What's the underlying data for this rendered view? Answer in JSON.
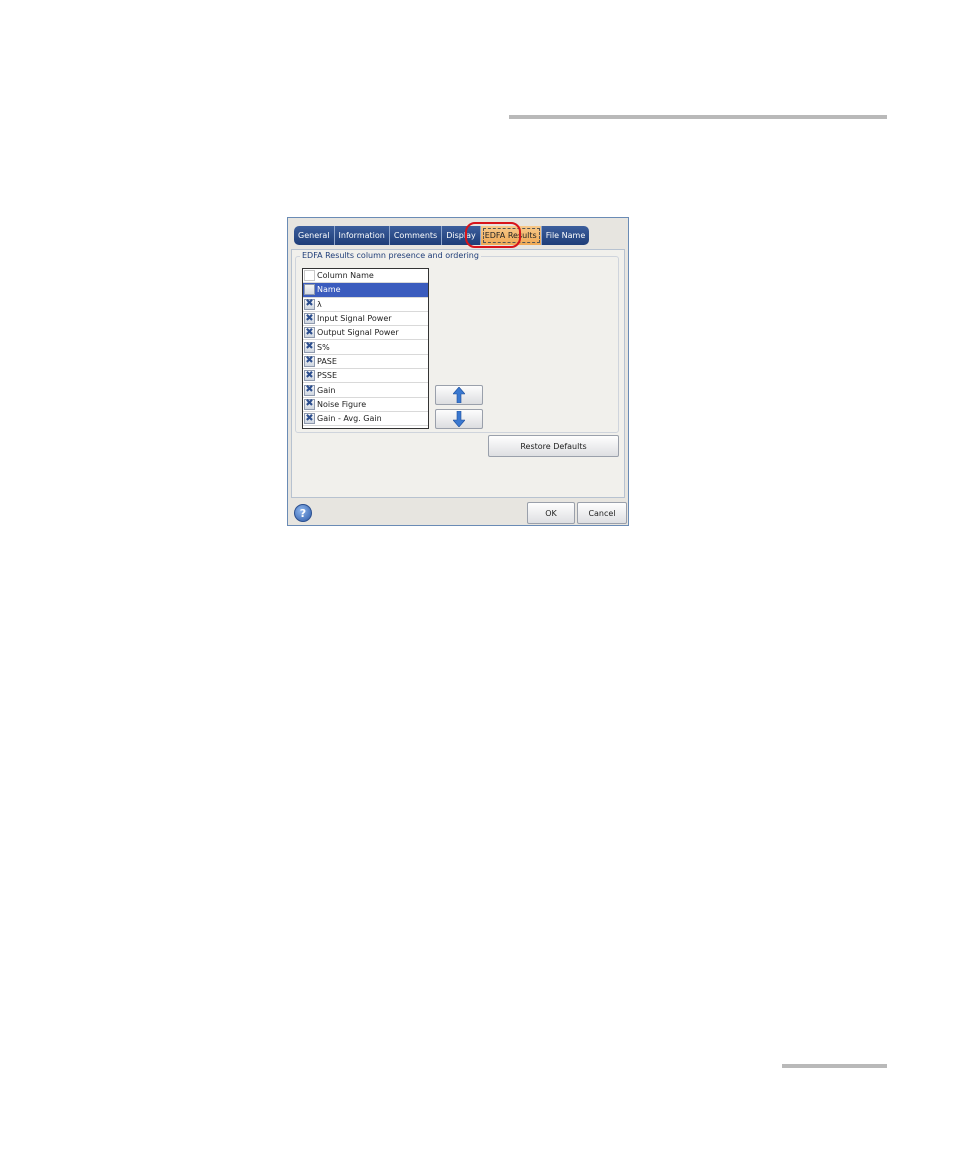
{
  "dialog": {
    "tabs": [
      {
        "label": "General"
      },
      {
        "label": "Information"
      },
      {
        "label": "Comments"
      },
      {
        "label": "Display"
      },
      {
        "label": "EDFA Results"
      },
      {
        "label": "File Name"
      }
    ],
    "active_tab": "EDFA Results",
    "group_label": "EDFA Results column presence and ordering",
    "list": {
      "header": "Column Name",
      "rows": [
        {
          "label": "Name",
          "checked": false,
          "selected": true
        },
        {
          "label": "λ",
          "checked": true,
          "selected": false
        },
        {
          "label": "Input Signal Power",
          "checked": true,
          "selected": false
        },
        {
          "label": "Output Signal Power",
          "checked": true,
          "selected": false
        },
        {
          "label": "S%",
          "checked": true,
          "selected": false
        },
        {
          "label": "PASE",
          "checked": true,
          "selected": false
        },
        {
          "label": "PSSE",
          "checked": true,
          "selected": false
        },
        {
          "label": "Gain",
          "checked": true,
          "selected": false
        },
        {
          "label": "Noise Figure",
          "checked": true,
          "selected": false
        },
        {
          "label": "Gain - Avg. Gain",
          "checked": true,
          "selected": false
        }
      ]
    },
    "buttons": {
      "restore_defaults": "Restore Defaults",
      "ok": "OK",
      "cancel": "Cancel",
      "help_glyph": "?"
    },
    "icons": {
      "move_up": "arrow-up-icon",
      "move_down": "arrow-down-icon",
      "checked_mark": "✖"
    },
    "colors": {
      "tab": "#1e3d78",
      "active_tab": "#f0a955",
      "selection": "#3b5cbe",
      "highlight_ring": "#d8141b"
    }
  }
}
